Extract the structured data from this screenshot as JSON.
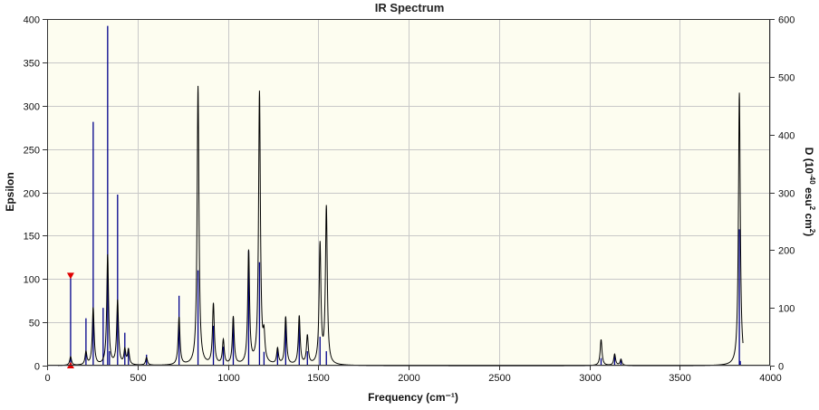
{
  "chart_data": {
    "type": "line",
    "title": "IR Spectrum",
    "xlabel": "Frequency (cm⁻¹)",
    "ylabel_left": "Epsilon",
    "ylabel_right_base": "D (10",
    "ylabel_right_exp1": "-40",
    "ylabel_right_mid": " esu",
    "ylabel_right_exp2": "2",
    "ylabel_right_tail": " cm",
    "ylabel_right_exp3": "2",
    "ylabel_right_close": ")",
    "xlim": [
      0,
      4000
    ],
    "ylim_left": [
      0,
      400
    ],
    "ylim_right": [
      0,
      600
    ],
    "x_ticks": [
      0,
      500,
      1000,
      1500,
      2000,
      2500,
      3000,
      3500,
      4000
    ],
    "y_ticks_left": [
      0,
      50,
      100,
      150,
      200,
      250,
      300,
      350,
      400
    ],
    "y_ticks_right": [
      0,
      100,
      200,
      300,
      400,
      500,
      600
    ],
    "grid": true,
    "colors": {
      "plot_bg": "#fdfdf0",
      "grid": "#c8c8c8",
      "spectrum": "#000000",
      "stick": "#00008b",
      "marker": "#e00000"
    },
    "series": [
      {
        "kind": "stick",
        "axis": "right",
        "x": [
          130,
          215,
          255,
          310,
          335,
          345,
          390,
          430,
          450,
          550,
          730,
          835,
          920,
          975,
          1030,
          1115,
          1175,
          1200,
          1275,
          1320,
          1395,
          1440,
          1510,
          1545,
          3065,
          3140,
          3175,
          3830,
          3835
        ],
        "values": [
          157,
          82,
          422,
          100,
          588,
          25,
          296,
          57,
          30,
          19,
          121,
          165,
          69,
          33,
          82,
          199,
          179,
          24,
          30,
          83,
          84,
          25,
          50,
          25,
          13,
          18,
          12,
          236,
          8
        ]
      },
      {
        "kind": "spectrum",
        "axis": "left",
        "peaks": [
          {
            "x": 130,
            "height": 10
          },
          {
            "x": 215,
            "height": 15
          },
          {
            "x": 255,
            "height": 66
          },
          {
            "x": 335,
            "height": 127
          },
          {
            "x": 390,
            "height": 74
          },
          {
            "x": 430,
            "height": 17
          },
          {
            "x": 450,
            "height": 17
          },
          {
            "x": 550,
            "height": 9
          },
          {
            "x": 730,
            "height": 55
          },
          {
            "x": 835,
            "height": 322
          },
          {
            "x": 920,
            "height": 70
          },
          {
            "x": 975,
            "height": 28
          },
          {
            "x": 1030,
            "height": 55
          },
          {
            "x": 1115,
            "height": 130
          },
          {
            "x": 1175,
            "height": 314
          },
          {
            "x": 1200,
            "height": 28
          },
          {
            "x": 1275,
            "height": 18
          },
          {
            "x": 1320,
            "height": 55
          },
          {
            "x": 1395,
            "height": 56
          },
          {
            "x": 1440,
            "height": 33
          },
          {
            "x": 1510,
            "height": 138
          },
          {
            "x": 1545,
            "height": 181
          },
          {
            "x": 3065,
            "height": 30
          },
          {
            "x": 3140,
            "height": 13
          },
          {
            "x": 3175,
            "height": 7
          },
          {
            "x": 3830,
            "height": 315
          }
        ]
      }
    ],
    "markers": [
      {
        "x": 130,
        "value": 104,
        "shape": "triangle-down"
      },
      {
        "x": 130,
        "value": 0,
        "shape": "triangle-up"
      }
    ]
  }
}
